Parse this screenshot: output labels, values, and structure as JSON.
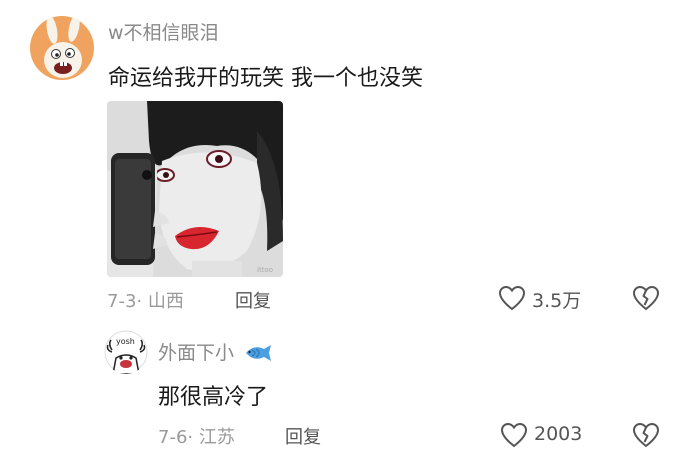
{
  "comment": {
    "username": "w不相信眼泪",
    "text": "命运给我开的玩笑 我一个也没笑",
    "date_location": "7-3· 山西",
    "reply_label": "回复",
    "like_count": "3.5万",
    "image_watermark": "ittoo"
  },
  "reply": {
    "username": "外面下小",
    "username_emoji": "fish-icon",
    "avatar_text": "yosh",
    "text": "那很高冷了",
    "date_location": "7-6· 江苏",
    "reply_label": "回复",
    "like_count": "2003"
  },
  "colors": {
    "username": "#8a8a8a",
    "text": "#1a1a1a",
    "meta": "#9a9a9a",
    "avatar_bg": "#f0a35e",
    "lips": "#d8262f"
  }
}
